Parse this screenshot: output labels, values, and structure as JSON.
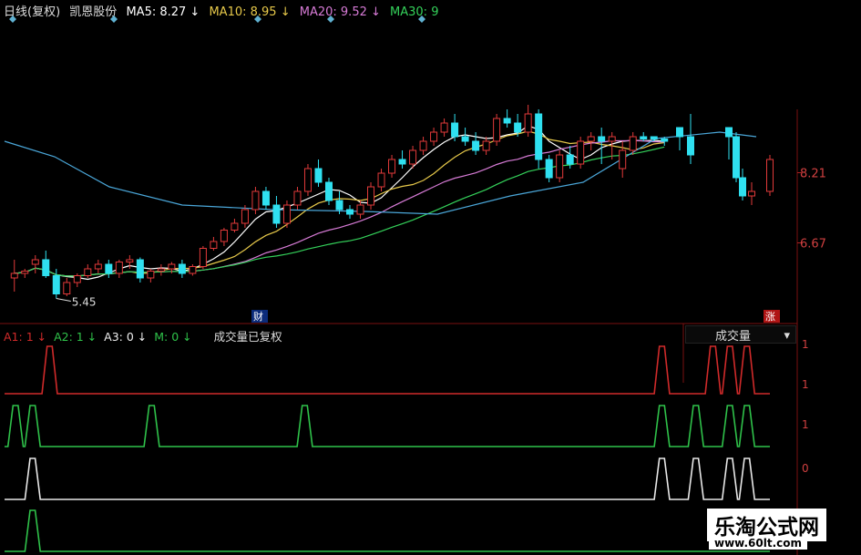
{
  "header": {
    "period": "日线(复权)",
    "stock": "凯恩股份",
    "ma5": "MA5: 8.27 ↓",
    "ma10": "MA10: 8.95 ↓",
    "ma20": "MA20: 9.52 ↓",
    "ma30": "MA30: 9",
    "colors": {
      "ma5": "#ffffff",
      "ma10": "#e6c84a",
      "ma20": "#d77bd6",
      "ma30": "#34d15a"
    }
  },
  "price_labels": {
    "low_label": "5.45",
    "axis_high": "8.21",
    "axis_low": "6.67",
    "cai_badge": "财",
    "zhang_badge": "涨"
  },
  "sub": {
    "a1": "A1: 1 ↓",
    "a2": "A2: 1 ↓",
    "a3": "A3: 0 ↓",
    "m": "M: 0 ↓",
    "note": "成交量已复权",
    "volume_button": "成交量",
    "axis": [
      "1",
      "1",
      "1",
      "0"
    ]
  },
  "watermark": {
    "title": "乐淘公式网",
    "url": "www.60lt.com"
  },
  "chart_data": [
    {
      "type": "candlestick",
      "title": "",
      "candles": [
        [
          5.9,
          6.3,
          5.6,
          6.0
        ],
        [
          6.0,
          6.1,
          5.9,
          6.05
        ],
        [
          6.2,
          6.4,
          6.0,
          6.3
        ],
        [
          6.3,
          6.5,
          5.9,
          5.95
        ],
        [
          5.95,
          6.1,
          5.45,
          5.55
        ],
        [
          5.55,
          5.9,
          5.5,
          5.8
        ],
        [
          5.8,
          6.0,
          5.7,
          5.95
        ],
        [
          5.95,
          6.2,
          5.9,
          6.1
        ],
        [
          6.1,
          6.3,
          6.0,
          6.2
        ],
        [
          6.2,
          6.3,
          5.9,
          6.0
        ],
        [
          6.0,
          6.3,
          5.9,
          6.25
        ],
        [
          6.25,
          6.4,
          6.1,
          6.3
        ],
        [
          6.3,
          6.35,
          5.8,
          5.9
        ],
        [
          5.9,
          6.1,
          5.8,
          6.05
        ],
        [
          6.05,
          6.2,
          5.95,
          6.1
        ],
        [
          6.1,
          6.25,
          6.0,
          6.2
        ],
        [
          6.2,
          6.3,
          5.9,
          6.0
        ],
        [
          6.0,
          6.2,
          5.95,
          6.15
        ],
        [
          6.15,
          6.6,
          6.1,
          6.55
        ],
        [
          6.55,
          6.8,
          6.5,
          6.7
        ],
        [
          6.7,
          7.0,
          6.6,
          6.95
        ],
        [
          6.95,
          7.2,
          6.9,
          7.1
        ],
        [
          7.1,
          7.5,
          7.0,
          7.4
        ],
        [
          7.4,
          7.9,
          7.3,
          7.8
        ],
        [
          7.8,
          7.9,
          7.4,
          7.5
        ],
        [
          7.5,
          7.7,
          7.0,
          7.1
        ],
        [
          7.1,
          7.6,
          7.0,
          7.5
        ],
        [
          7.5,
          7.9,
          7.4,
          7.8
        ],
        [
          7.8,
          8.4,
          7.7,
          8.3
        ],
        [
          8.3,
          8.5,
          7.9,
          8.0
        ],
        [
          8.0,
          8.1,
          7.5,
          7.6
        ],
        [
          7.6,
          7.8,
          7.3,
          7.4
        ],
        [
          7.4,
          7.5,
          7.2,
          7.3
        ],
        [
          7.3,
          7.6,
          7.2,
          7.5
        ],
        [
          7.5,
          8.0,
          7.4,
          7.9
        ],
        [
          7.9,
          8.3,
          7.8,
          8.2
        ],
        [
          8.2,
          8.6,
          8.1,
          8.5
        ],
        [
          8.5,
          8.7,
          8.3,
          8.4
        ],
        [
          8.4,
          8.8,
          8.3,
          8.7
        ],
        [
          8.7,
          9.0,
          8.6,
          8.9
        ],
        [
          8.9,
          9.2,
          8.8,
          9.1
        ],
        [
          9.1,
          9.4,
          9.0,
          9.3
        ],
        [
          9.3,
          9.5,
          8.9,
          9.0
        ],
        [
          9.0,
          9.2,
          8.8,
          8.9
        ],
        [
          8.9,
          9.1,
          8.6,
          8.7
        ],
        [
          8.7,
          9.0,
          8.6,
          8.9
        ],
        [
          8.9,
          9.5,
          8.8,
          9.4
        ],
        [
          9.4,
          9.6,
          9.2,
          9.3
        ],
        [
          9.3,
          9.5,
          9.0,
          9.1
        ],
        [
          9.1,
          9.7,
          9.0,
          9.5
        ],
        [
          9.5,
          9.6,
          8.3,
          8.5
        ],
        [
          8.5,
          8.6,
          8.0,
          8.1
        ],
        [
          8.1,
          8.7,
          8.0,
          8.6
        ],
        [
          8.6,
          8.8,
          8.3,
          8.4
        ],
        [
          8.4,
          9.0,
          8.3,
          8.9
        ],
        [
          8.9,
          9.1,
          8.7,
          9.0
        ],
        [
          9.0,
          9.2,
          8.4,
          8.9
        ],
        [
          8.9,
          9.1,
          8.5,
          9.0
        ],
        [
          8.3,
          8.9,
          8.1,
          8.7
        ],
        [
          8.7,
          9.1,
          8.6,
          9.0
        ],
        [
          9.0,
          9.1,
          8.9,
          8.95
        ],
        [
          9.0,
          9.0,
          8.9,
          8.95
        ],
        [
          8.95,
          9.0,
          8.8,
          8.9
        ]
      ],
      "gap_candles": [
        [
          9.2,
          9.2,
          8.7,
          9.0
        ],
        [
          9.0,
          9.5,
          8.4,
          8.6
        ],
        [
          9.2,
          9.2,
          8.5,
          9.0
        ],
        [
          9.0,
          9.1,
          8.0,
          8.1
        ],
        [
          8.1,
          8.3,
          7.6,
          7.7
        ],
        [
          7.7,
          8.0,
          7.5,
          7.8
        ],
        [
          7.8,
          8.6,
          7.7,
          8.5
        ]
      ],
      "ylim": [
        5.2,
        9.8
      ],
      "ticks": [
        8.21,
        6.67
      ]
    },
    {
      "type": "line",
      "title": "",
      "series": [
        {
          "name": "A1",
          "color": "#d02a2a",
          "values": [
            0,
            0,
            1,
            0,
            0,
            0,
            0,
            0,
            0,
            0,
            0,
            0,
            0,
            0,
            0,
            0,
            0,
            0,
            0,
            0,
            0,
            0,
            0,
            0,
            0,
            0,
            0,
            0,
            0,
            0,
            0,
            0,
            0,
            0,
            0,
            0,
            0,
            0,
            1,
            0,
            0,
            1,
            1,
            1,
            0
          ]
        },
        {
          "name": "A2",
          "color": "#2fc24a",
          "values": [
            1,
            1,
            0,
            0,
            0,
            0,
            0,
            0,
            1,
            0,
            0,
            0,
            0,
            0,
            0,
            0,
            0,
            1,
            0,
            0,
            0,
            0,
            0,
            0,
            0,
            0,
            0,
            0,
            0,
            0,
            0,
            0,
            0,
            0,
            0,
            0,
            0,
            0,
            1,
            0,
            1,
            0,
            1,
            1,
            0
          ]
        },
        {
          "name": "A3",
          "color": "#e8e8e8",
          "values": [
            0,
            1,
            0,
            0,
            0,
            0,
            0,
            0,
            0,
            0,
            0,
            0,
            0,
            0,
            0,
            0,
            0,
            0,
            0,
            0,
            0,
            0,
            0,
            0,
            0,
            0,
            0,
            0,
            0,
            0,
            0,
            0,
            0,
            0,
            0,
            0,
            0,
            0,
            1,
            0,
            1,
            0,
            1,
            1,
            0
          ]
        },
        {
          "name": "M",
          "color": "#2fc24a",
          "values": [
            0,
            1,
            0,
            0,
            0,
            0,
            0,
            0,
            0,
            0,
            0,
            0,
            0,
            0,
            0,
            0,
            0,
            0,
            0,
            0,
            0,
            0,
            0,
            0,
            0,
            0,
            0,
            0,
            0,
            0,
            0,
            0,
            0,
            0,
            0,
            0,
            0,
            0,
            0,
            0,
            0,
            0,
            0,
            0,
            0
          ]
        }
      ]
    }
  ]
}
